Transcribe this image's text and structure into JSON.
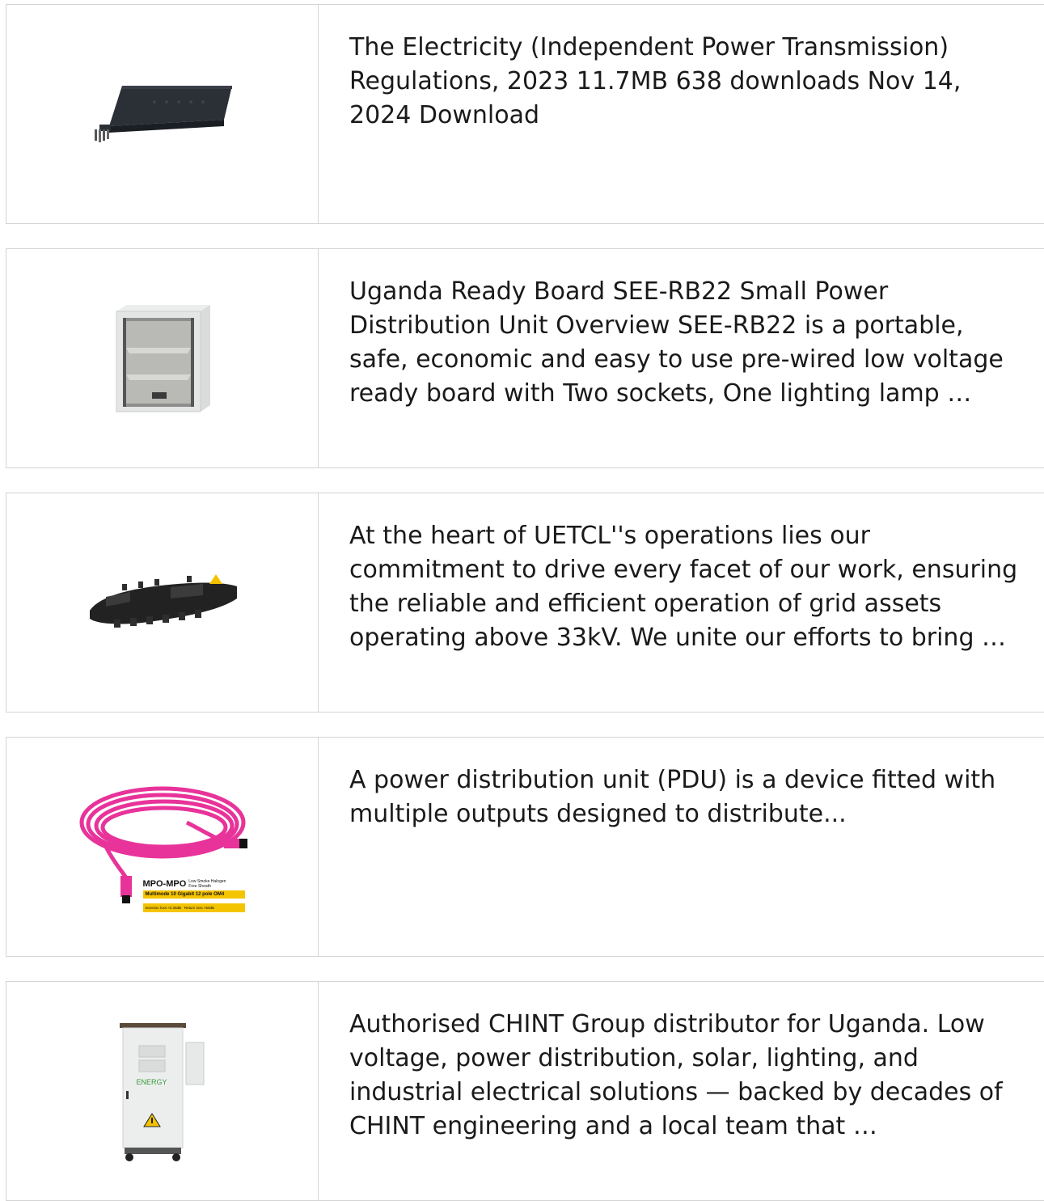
{
  "items": [
    {
      "image": "rack-drawer-image",
      "text": "The Electricity (Independent Power Transmission) Regulations, 2023 11.7MB 638 downloads Nov 14, 2024 Download"
    },
    {
      "image": "cabinet-shelf-image",
      "text": "Uganda Ready Board SEE-RB22 Small Power Distribution Unit Overview SEE-RB22 is a portable, safe, economic and easy to use pre-wired low voltage ready board with Two sockets, One lighting lamp …"
    },
    {
      "image": "splice-closure-image",
      "text": "At the heart of UETCL''s operations lies our commitment to drive every facet of our work, ensuring the reliable and efficient operation of grid assets operating above 33kV. We unite our efforts to bring …"
    },
    {
      "image": "fiber-cable-image",
      "text": "A power distribution unit (PDU) is a device fitted with multiple outputs designed to distribute...",
      "label": {
        "title": "MPO-MPO",
        "subtitle": "Low Smoke Halogen Free Sheath",
        "band": "Multimode 10 Gigabit 12 pole OM4",
        "specs": "Insertion loss <0.35dB   Return loss >50dB"
      }
    },
    {
      "image": "energy-cabinet-image",
      "text": "Authorised CHINT Group distributor for Uganda. Low voltage, power distribution, solar, lighting, and industrial electrical solutions — backed by decades of CHINT engineering and a local team that …",
      "label": {
        "brand": "ENERGY"
      }
    }
  ],
  "colors": {
    "border": "#d4d4d4",
    "text": "#1a1a1a",
    "cable": "#e8339a",
    "label_band": "#f5c400"
  }
}
